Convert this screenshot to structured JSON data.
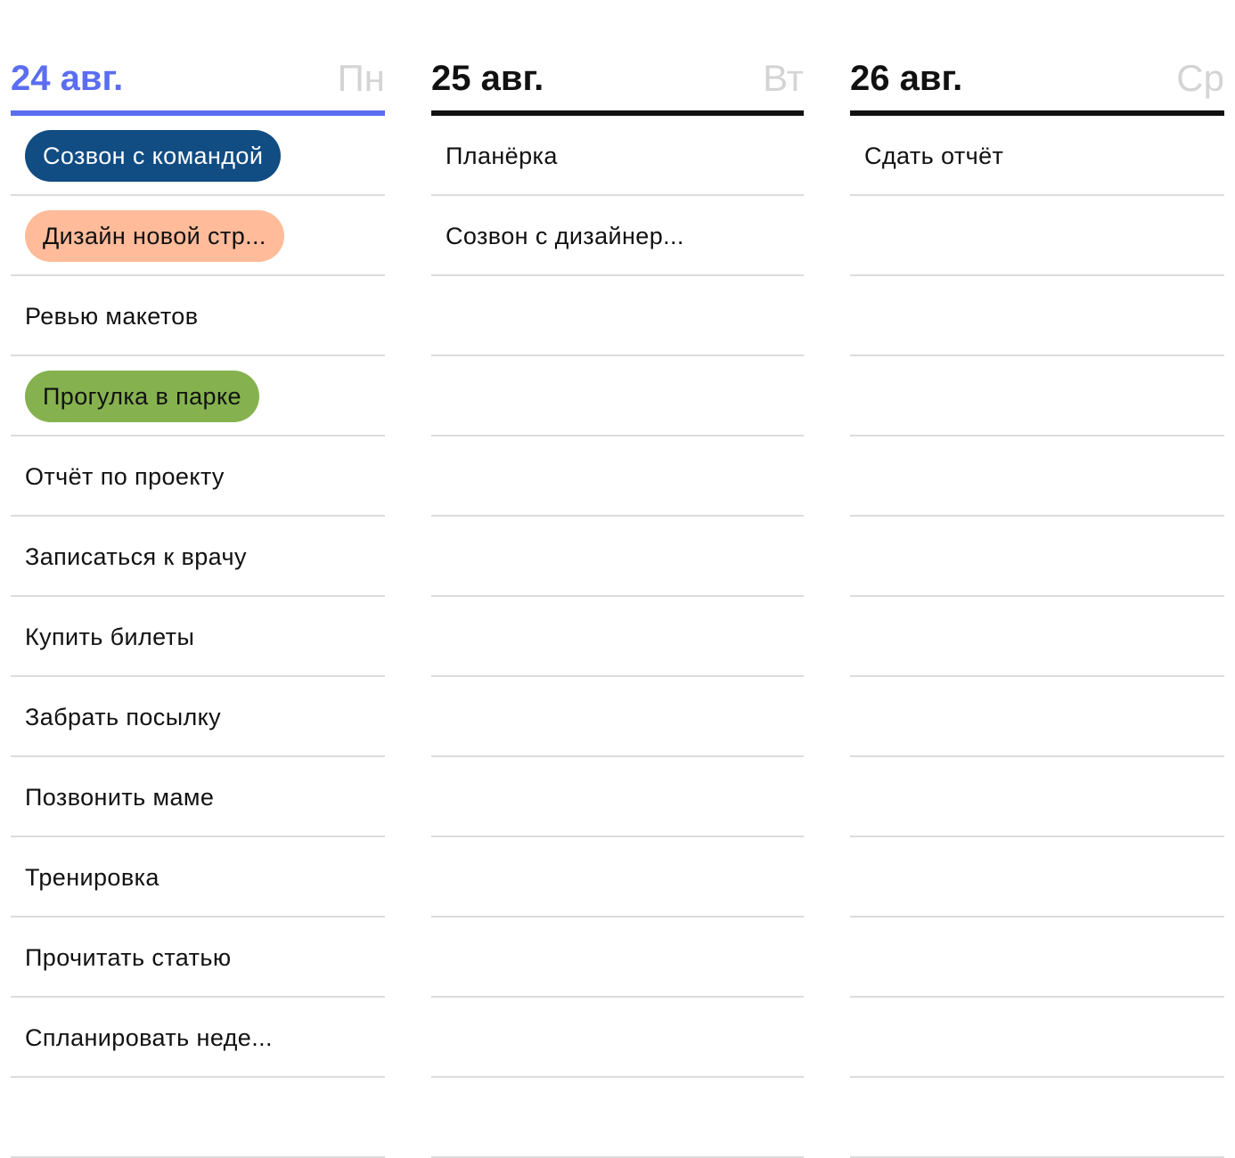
{
  "colors": {
    "today_accent": "#5b6df0",
    "header_text": "#111111",
    "weekday_text": "#d4d4d4",
    "row_divider": "#dcdcdc",
    "pill_blue": "#114c83",
    "pill_peach": "#ffbb9a",
    "pill_green": "#85b24f"
  },
  "days": [
    {
      "date": "24 авг.",
      "weekday": "Пн",
      "is_today": true,
      "tasks": [
        {
          "title": "Созвон с командой",
          "color": "#114c83",
          "text_color": "#ffffff"
        },
        {
          "title": "Дизайн новой стр...",
          "color": "#ffbb9a",
          "text_color": "#111111"
        },
        {
          "title": "Ревью макетов",
          "color": null
        },
        {
          "title": "Прогулка в парке",
          "color": "#85b24f",
          "text_color": "#111111"
        },
        {
          "title": "Отчёт по проекту",
          "color": null
        },
        {
          "title": "Записаться к врачу",
          "color": null
        },
        {
          "title": "Купить билеты",
          "color": null
        },
        {
          "title": "Забрать посылку",
          "color": null
        },
        {
          "title": "Позвонить маме",
          "color": null
        },
        {
          "title": "Тренировка",
          "color": null
        },
        {
          "title": "Прочитать статью",
          "color": null
        },
        {
          "title": "Спланировать неде...",
          "color": null
        },
        {
          "title": "",
          "color": null
        }
      ]
    },
    {
      "date": "25 авг.",
      "weekday": "Вт",
      "is_today": false,
      "tasks": [
        {
          "title": "Планёрка",
          "color": null
        },
        {
          "title": "Созвон с дизайнер...",
          "color": null
        },
        {
          "title": "",
          "color": null
        },
        {
          "title": "",
          "color": null
        },
        {
          "title": "",
          "color": null
        },
        {
          "title": "",
          "color": null
        },
        {
          "title": "",
          "color": null
        },
        {
          "title": "",
          "color": null
        },
        {
          "title": "",
          "color": null
        },
        {
          "title": "",
          "color": null
        },
        {
          "title": "",
          "color": null
        },
        {
          "title": "",
          "color": null
        },
        {
          "title": "",
          "color": null
        }
      ]
    },
    {
      "date": "26 авг.",
      "weekday": "Ср",
      "is_today": false,
      "tasks": [
        {
          "title": "Сдать отчёт",
          "color": null
        },
        {
          "title": "",
          "color": null
        },
        {
          "title": "",
          "color": null
        },
        {
          "title": "",
          "color": null
        },
        {
          "title": "",
          "color": null
        },
        {
          "title": "",
          "color": null
        },
        {
          "title": "",
          "color": null
        },
        {
          "title": "",
          "color": null
        },
        {
          "title": "",
          "color": null
        },
        {
          "title": "",
          "color": null
        },
        {
          "title": "",
          "color": null
        },
        {
          "title": "",
          "color": null
        },
        {
          "title": "",
          "color": null
        }
      ]
    }
  ]
}
